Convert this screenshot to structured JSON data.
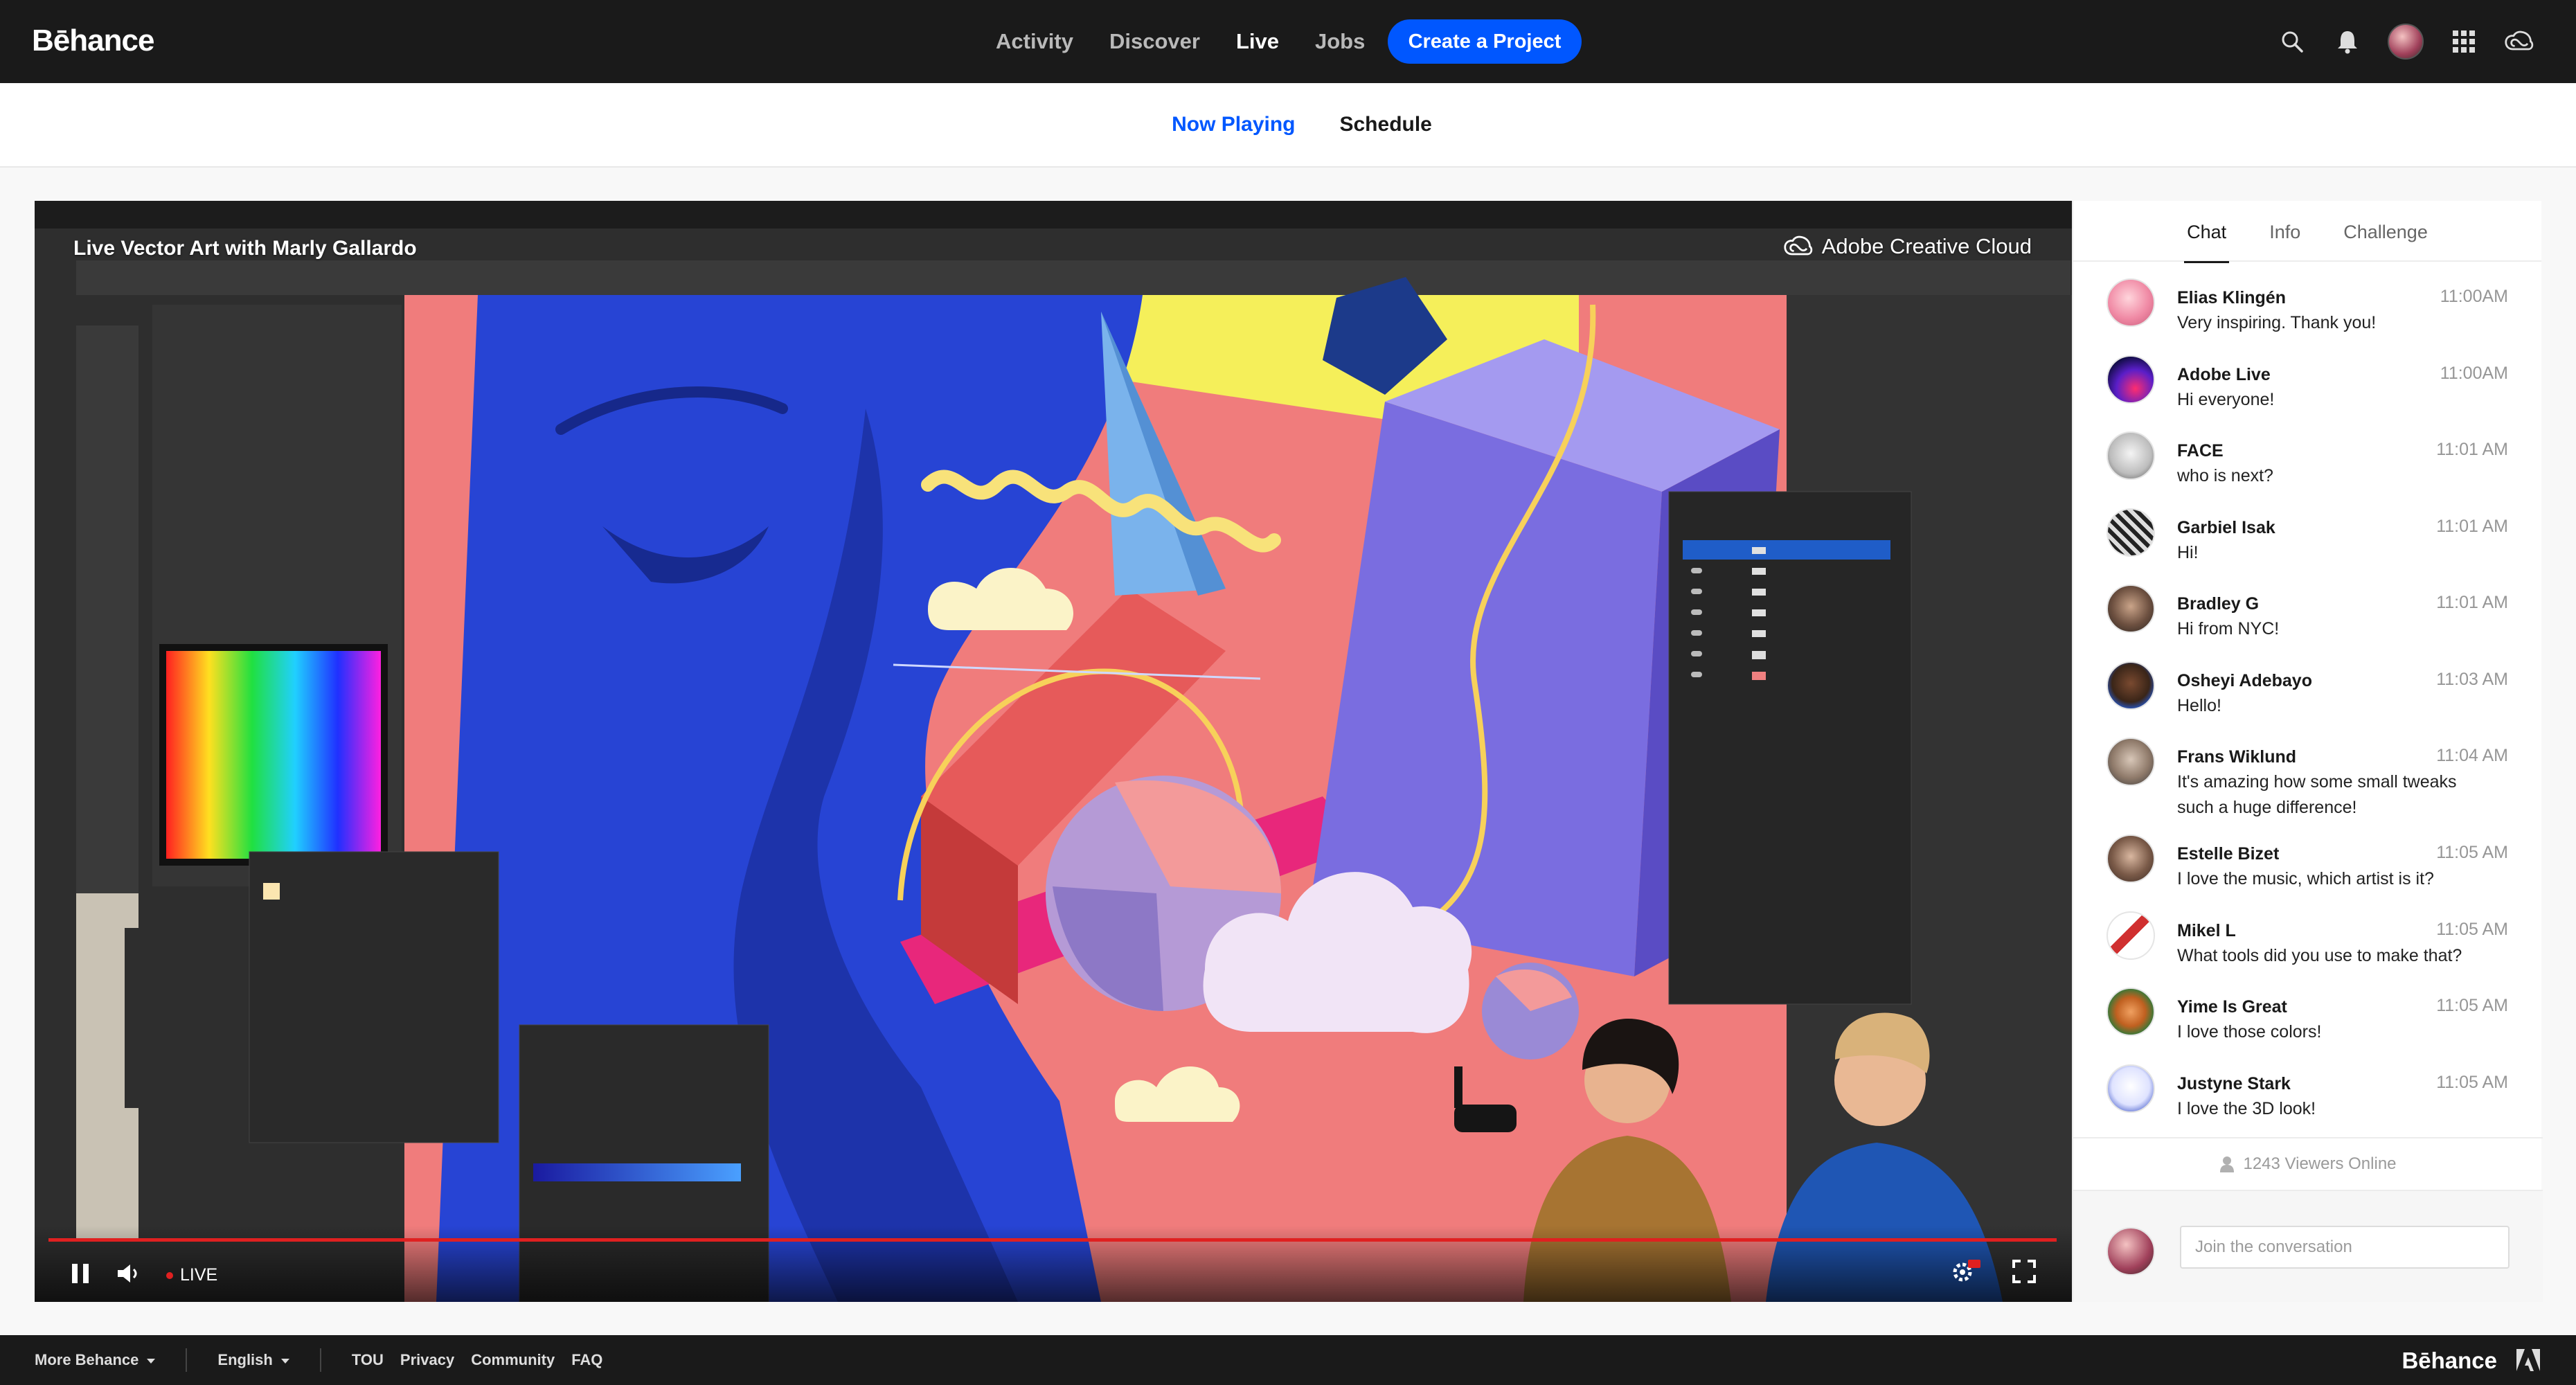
{
  "header": {
    "logo": "Bēhance",
    "nav": [
      {
        "label": "Activity",
        "active": false
      },
      {
        "label": "Discover",
        "active": false
      },
      {
        "label": "Live",
        "active": true
      },
      {
        "label": "Jobs",
        "active": false
      }
    ],
    "create_button": "Create a Project",
    "icons": [
      "search-icon",
      "bell-icon",
      "user-avatar",
      "apps-grid-icon",
      "creative-cloud-icon"
    ]
  },
  "subnav": {
    "tabs": [
      {
        "label": "Now Playing",
        "active": true
      },
      {
        "label": "Schedule",
        "active": false
      }
    ]
  },
  "video": {
    "title": "Live Vector Art with Marly Gallardo",
    "brand": "Adobe Creative Cloud",
    "live_label": "LIVE",
    "hd_badge": "HD",
    "colors": {
      "accent": "#e02020",
      "background": "#f07f7f",
      "face": "#2741c9"
    }
  },
  "chat": {
    "tabs": [
      {
        "label": "Chat",
        "active": true
      },
      {
        "label": "Info",
        "active": false
      },
      {
        "label": "Challenge",
        "active": false
      }
    ],
    "messages": [
      {
        "name": "Elias Klingén",
        "time": "11:00AM",
        "text": "Very inspiring. Thank you!"
      },
      {
        "name": "Adobe Live",
        "time": "11:00AM",
        "text": "Hi everyone!"
      },
      {
        "name": "FACE",
        "time": "11:01 AM",
        "text": "who is next?"
      },
      {
        "name": "Garbiel Isak",
        "time": "11:01 AM",
        "text": "Hi!"
      },
      {
        "name": "Bradley G",
        "time": "11:01 AM",
        "text": "Hi from NYC!"
      },
      {
        "name": "Osheyi Adebayo",
        "time": "11:03 AM",
        "text": "Hello!"
      },
      {
        "name": "Frans Wiklund",
        "time": "11:04 AM",
        "text": "It's amazing how some small tweaks such a huge difference!"
      },
      {
        "name": "Estelle Bizet",
        "time": "11:05 AM",
        "text": "I love the music, which artist is it?"
      },
      {
        "name": "Mikel L",
        "time": "11:05 AM",
        "text": "What tools did you use to make that?"
      },
      {
        "name": "Yime Is Great",
        "time": "11:05 AM",
        "text": "I love those colors!"
      },
      {
        "name": "Justyne Stark",
        "time": "11:05 AM",
        "text": "I love the 3D look!"
      }
    ],
    "viewers": "1243 Viewers Online",
    "composer_placeholder": "Join the conversation"
  },
  "footer": {
    "more": "More Behance",
    "language": "English",
    "links": [
      "TOU",
      "Privacy",
      "Community",
      "FAQ"
    ],
    "logo": "Bēhance"
  }
}
